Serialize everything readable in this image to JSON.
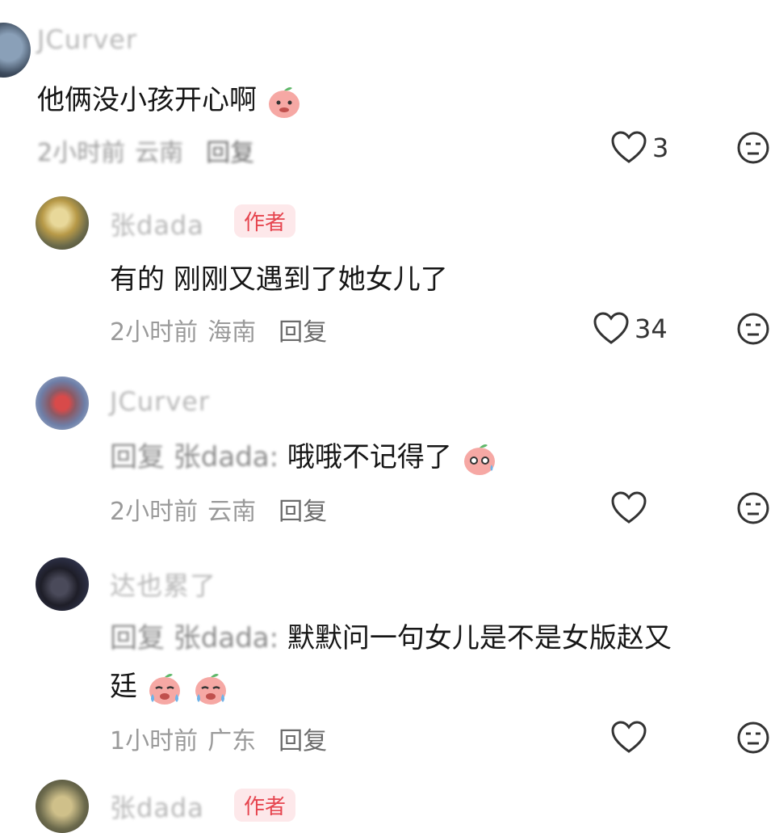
{
  "comments": [
    {
      "username": "JCurver",
      "text": "他俩没小孩开心啊",
      "time": "2小时前",
      "region": "云南",
      "reply_label": "回复",
      "likes": "3",
      "emoji": "peach-shy"
    },
    {
      "username": "张dada",
      "author_badge": "作者",
      "text": "有的 刚刚又遇到了她女儿了",
      "time": "2小时前",
      "region": "海南",
      "reply_label": "回复",
      "likes": "34"
    },
    {
      "username": "JCurver",
      "reply_prefix": "回复 张dada:",
      "text": " 哦哦不记得了",
      "time": "2小时前",
      "region": "云南",
      "reply_label": "回复",
      "emoji": "peach-sweat"
    },
    {
      "username": "达也累了",
      "reply_prefix": "回复 张dada:",
      "text": " 默默问一句女儿是不是女版赵又",
      "text_line2": "廷",
      "time": "1小时前",
      "region": "广东",
      "reply_label": "回复",
      "emoji": "peach-crying"
    },
    {
      "username": "张dada",
      "author_badge": "作者"
    }
  ],
  "colors": {
    "author_badge_bg": "#fde8ea",
    "author_badge_text": "#e6454f",
    "meta_gray": "#9a9a9a"
  }
}
